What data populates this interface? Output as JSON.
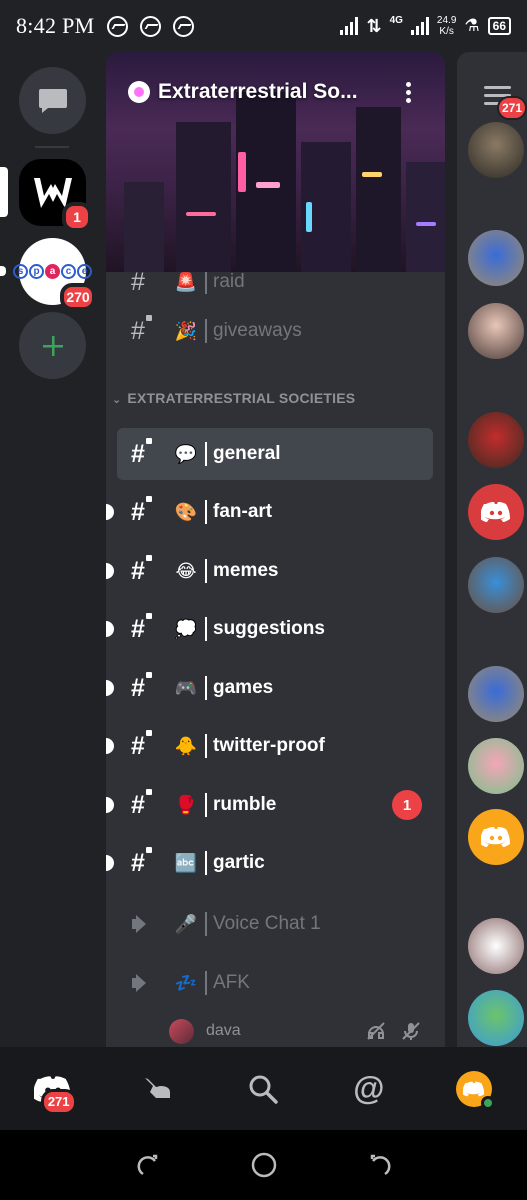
{
  "status_bar": {
    "time": "8:42 PM",
    "network": "4G",
    "speed_value": "24.9",
    "speed_unit": "K/s",
    "battery": "66"
  },
  "servers": [
    {
      "name": "W server",
      "badge": "1"
    },
    {
      "name": "space",
      "badge": "270"
    }
  ],
  "server_header": {
    "title": "Extraterrestrial So..."
  },
  "channels_top": [
    {
      "emoji": "🚨",
      "name": "raid"
    },
    {
      "emoji": "🎉",
      "name": "giveaways"
    }
  ],
  "category": {
    "label": "EXTRATERRESTRIAL SOCIETIES"
  },
  "channels": [
    {
      "emoji": "💬",
      "name": "general"
    },
    {
      "emoji": "🎨",
      "name": "fan-art"
    },
    {
      "emoji": "😂",
      "name": "memes"
    },
    {
      "emoji": "💭",
      "name": "suggestions"
    },
    {
      "emoji": "🎮",
      "name": "games"
    },
    {
      "emoji": "🐥",
      "name": "twitter-proof"
    },
    {
      "emoji": "🥊",
      "name": "rumble",
      "mentions": "1"
    },
    {
      "emoji": "🔤",
      "name": "gartic"
    }
  ],
  "voice_channels": [
    {
      "emoji": "🎤",
      "name": "Voice Chat 1"
    },
    {
      "emoji": "💤",
      "name": "AFK"
    }
  ],
  "voice_user": {
    "name": "dava"
  },
  "members": {
    "badge": "271"
  },
  "bottom_nav": {
    "home_badge": "271"
  },
  "colors": {
    "background": "#202225",
    "panel": "#2f3136",
    "selected": "#42464d",
    "mention_red": "#ed4245",
    "online_green": "#3ba55c",
    "blurple": "#5865f2"
  }
}
